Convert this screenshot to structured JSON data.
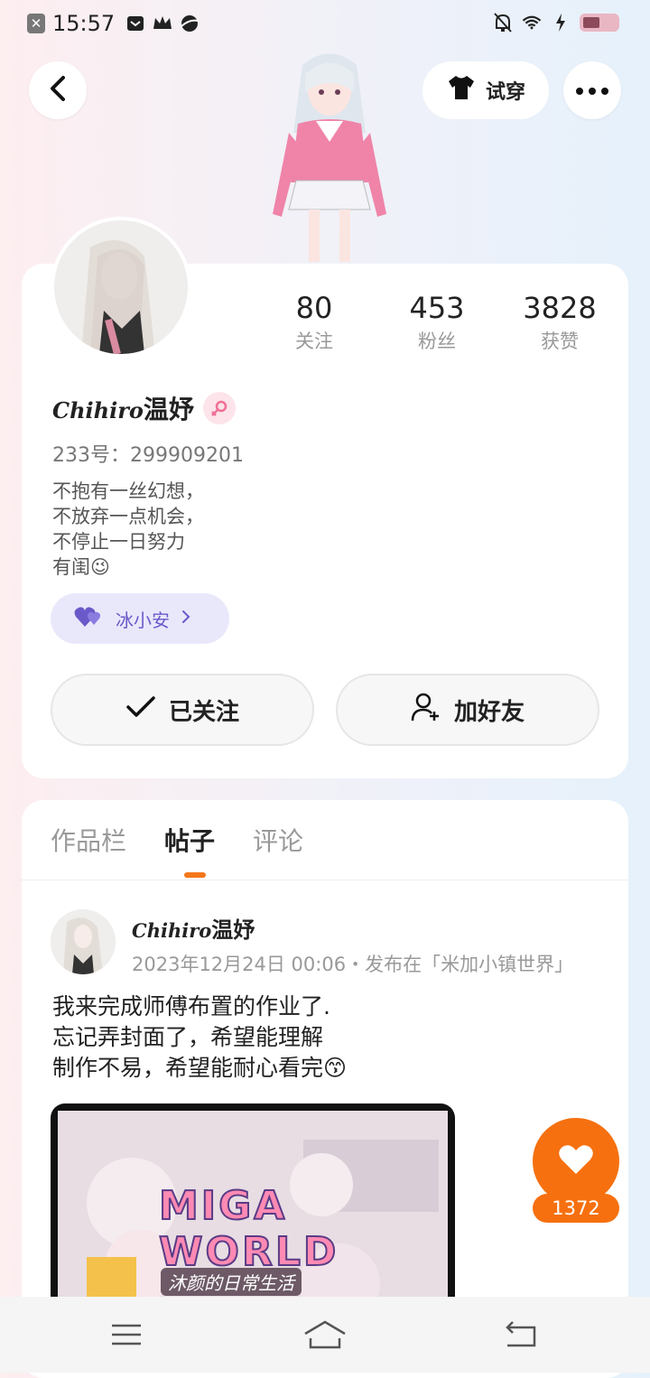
{
  "status_bar": {
    "time": "15:57",
    "icons_left": [
      "close-box-icon",
      "mail-icon",
      "crown-icon",
      "planet-icon"
    ],
    "icons_right": [
      "bell-muted-icon",
      "wifi-icon",
      "charging-icon",
      "battery-icon"
    ]
  },
  "header": {
    "back_icon": "chevron-left-icon",
    "try_on_label": "试穿",
    "try_on_icon": "tshirt-icon",
    "more_icon": "more-dots-icon"
  },
  "profile": {
    "stats": [
      {
        "value": "80",
        "label": "关注"
      },
      {
        "value": "453",
        "label": "粉丝"
      },
      {
        "value": "3828",
        "label": "获赞"
      }
    ],
    "name_script": "Chihiro",
    "name_cn": "温妤",
    "gender_icon": "female-icon",
    "uid": "233号：299909201",
    "bio": [
      "不抱有一丝幻想，",
      "不放弃一点机会，",
      "不停止一日努力",
      "有闺😉"
    ],
    "tag_label": "冰小安",
    "tag_icon": "hearts-icon",
    "followed_label": "已关注",
    "add_friend_label": "加好友"
  },
  "tabs": [
    {
      "label": "作品栏",
      "active": false
    },
    {
      "label": "帖子",
      "active": true
    },
    {
      "label": "评论",
      "active": false
    }
  ],
  "post": {
    "author_script": "Chihiro",
    "author_cn": "温妤",
    "meta": "2023年12月24日 00:06・发布在「米加小镇世界」",
    "text": [
      "我来完成师傅布置的作业了.",
      "忘记弄封面了，希望能理解",
      "制作不易，希望能耐心看完😙"
    ],
    "image_title": "MIGA WORLD",
    "image_subtitle": "沐颜的日常生活"
  },
  "like": {
    "count": "1372",
    "icon": "heart-icon",
    "color": "#f6700f"
  },
  "nav_bar": {
    "icons": [
      "menu-icon",
      "home-icon",
      "back-icon"
    ]
  },
  "colors": {
    "accent_orange": "#f5761a",
    "tag_bg": "#e9e8fb",
    "tag_text": "#6a5ac9"
  }
}
